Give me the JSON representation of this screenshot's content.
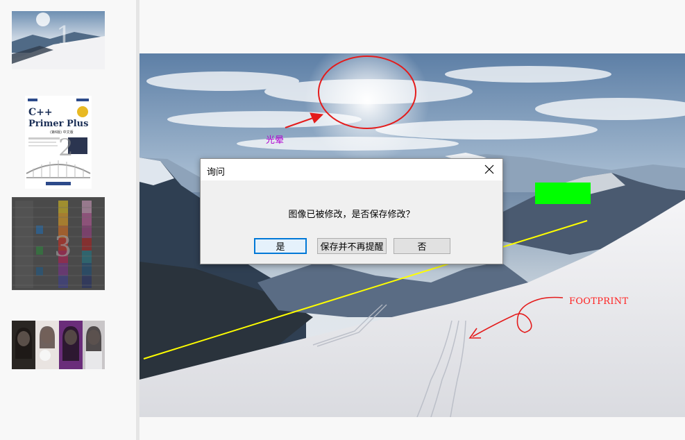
{
  "thumbnails": [
    {
      "number": "1",
      "label": "snow-mountain-thumbnail"
    },
    {
      "number": "2",
      "book_title_line1": "C++",
      "book_title_line2": "Primer Plus",
      "book_subtitle": "(第6版) 中文版"
    },
    {
      "number": "3",
      "label": "color-table-thumbnail"
    },
    {
      "number": "",
      "label": "portrait-photos-thumbnail"
    }
  ],
  "annotations": {
    "sun_label": "光晕",
    "footprint_label": "FOOTPRINT",
    "colors": {
      "ellipse": "#e41b1b",
      "arrow": "#e41b1b",
      "line": "#ffff00",
      "rect": "#00ff00",
      "sun_label": "#b000d0"
    }
  },
  "dialog": {
    "title": "询问",
    "message": "图像已被修改，是否保存修改？",
    "buttons": {
      "yes": "是",
      "save_no_remind": "保存并不再提醒",
      "no": "否"
    }
  }
}
